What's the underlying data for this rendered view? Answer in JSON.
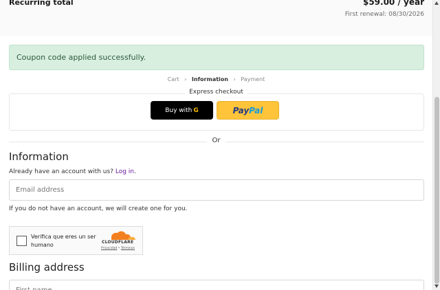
{
  "summary": {
    "label": "Recurring total",
    "price": "$59.00 / year",
    "renewal": "First renewal: 08/30/2026"
  },
  "notice": {
    "text": "Coupon code applied successfully."
  },
  "breadcrumb": {
    "items": [
      "Cart",
      "Information",
      "Payment"
    ],
    "active": "Information"
  },
  "express": {
    "title": "Express checkout",
    "gpay_label": "Buy with",
    "paypal_part1": "Pay",
    "paypal_part2": "Pal"
  },
  "divider": {
    "text": "Or"
  },
  "information": {
    "title": "Information",
    "account_prefix": "Already have an account with us?",
    "login_link": "Log in",
    "account_suffix": ".",
    "email_placeholder": "Email address",
    "hint": "If you do not have an account, we will create one for you."
  },
  "turnstile": {
    "text": "Verifica que eres un ser humano",
    "brand": "CLOUDFLARE",
    "privacy": "Privacidad",
    "separator": " • ",
    "terms": "Términos"
  },
  "billing": {
    "title": "Billing address",
    "first_name_placeholder": "First name"
  },
  "colors": {
    "notice_bg": "#d8efe0",
    "notice_text": "#2e5a3c",
    "link": "#6a1b9a",
    "paypal_yellow": "#ffc439",
    "cloudflare_orange": "#f38020"
  }
}
